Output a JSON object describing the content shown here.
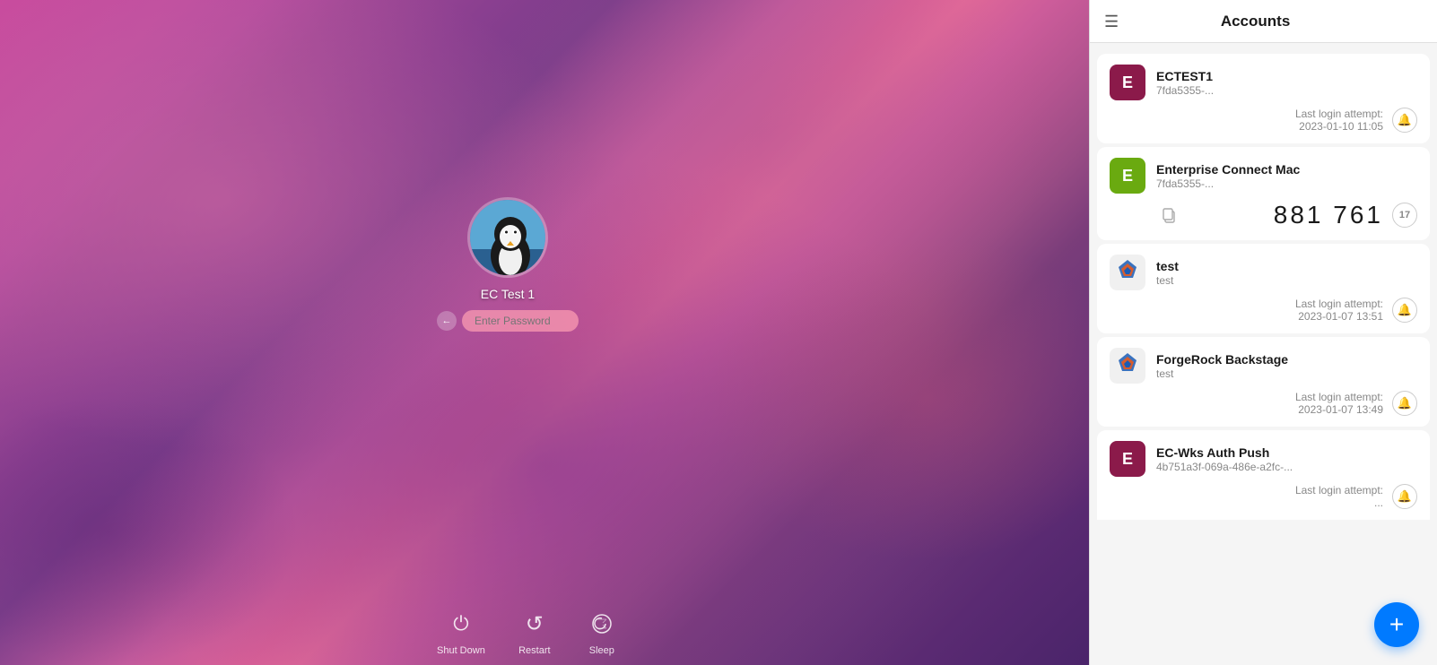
{
  "desktop": {
    "user": {
      "name": "EC Test 1",
      "password_placeholder": "Enter Password"
    },
    "dock": [
      {
        "label": "Shut Down",
        "icon": "⏻"
      },
      {
        "label": "Restart",
        "icon": "↺"
      },
      {
        "label": "Sleep",
        "icon": "☽"
      }
    ]
  },
  "panel": {
    "title": "Accounts",
    "hamburger_label": "≡",
    "add_button_label": "+",
    "accounts": [
      {
        "id": "ectest1",
        "name": "ECTEST1",
        "account_id": "7fda5355-...",
        "icon_color": "#8B1A4A",
        "icon_letter": "E",
        "type": "login",
        "login_attempt_label": "Last login attempt:",
        "login_attempt_date": "2023-01-10 11:05"
      },
      {
        "id": "enterprise-connect-mac",
        "name": "Enterprise Connect Mac",
        "account_id": "7fda5355-...",
        "icon_color": "#5a8c1a",
        "icon_letter": "E",
        "type": "totp",
        "totp_code": "881 761",
        "totp_timer": "17"
      },
      {
        "id": "test",
        "name": "test",
        "account_id": "test",
        "icon_color": null,
        "icon_letter": null,
        "icon_type": "forgerock",
        "type": "login",
        "login_attempt_label": "Last login attempt:",
        "login_attempt_date": "2023-01-07 13:51"
      },
      {
        "id": "forgerock-backstage",
        "name": "ForgeRock Backstage",
        "account_id": "test",
        "icon_color": null,
        "icon_letter": null,
        "icon_type": "forgerock",
        "type": "login",
        "login_attempt_label": "Last login attempt:",
        "login_attempt_date": "2023-01-07 13:49"
      },
      {
        "id": "ec-wks-auth-push",
        "name": "EC-Wks Auth Push",
        "account_id": "4b751a3f-069a-486e-a2fc-...",
        "icon_color": "#8B1A4A",
        "icon_letter": "E",
        "type": "partial",
        "login_attempt_label": "Last login attempt:",
        "login_attempt_date": ""
      }
    ]
  },
  "colors": {
    "ectest_bg": "#8B1A4A",
    "enterprise_bg": "#6aaa10",
    "forgerock_orange": "#e85a1e",
    "forgerock_blue": "#1a5cb5",
    "add_fab": "#007aff"
  }
}
